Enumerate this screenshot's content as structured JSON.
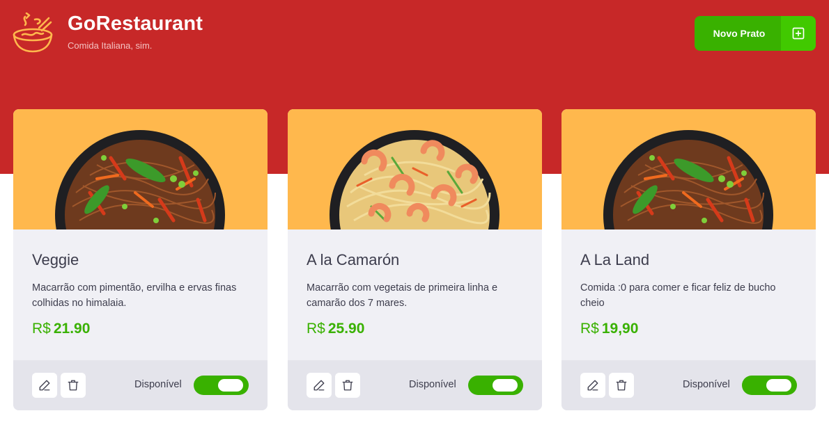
{
  "header": {
    "title": "GoRestaurant",
    "subtitle": "Comida Italiana, sim.",
    "new_dish_label": "Novo Prato",
    "logo_icon": "bowl-icon",
    "add_icon": "plus-square-icon"
  },
  "colors": {
    "header_red": "#c72828",
    "accent_green": "#39b100",
    "card_image_bg": "#ffb84d"
  },
  "food_cards": [
    {
      "name": "Veggie",
      "description": "Macarrão com pimentão, ervilha e ervas finas colhidas no himalaia.",
      "currency": "R$",
      "price": "21.90",
      "available_label": "Disponível",
      "available": true,
      "image": "noodles-veggie"
    },
    {
      "name": "A la Camarón",
      "description": "Macarrão com vegetais de primeira linha e camarão dos 7 mares.",
      "currency": "R$",
      "price": "25.90",
      "available_label": "Disponível",
      "available": true,
      "image": "noodles-shrimp"
    },
    {
      "name": "A La Land",
      "description": "Comida :0 para comer e ficar feliz de bucho cheio",
      "currency": "R$",
      "price": "19,90",
      "available_label": "Disponível",
      "available": true,
      "image": "noodles-veggie"
    }
  ]
}
